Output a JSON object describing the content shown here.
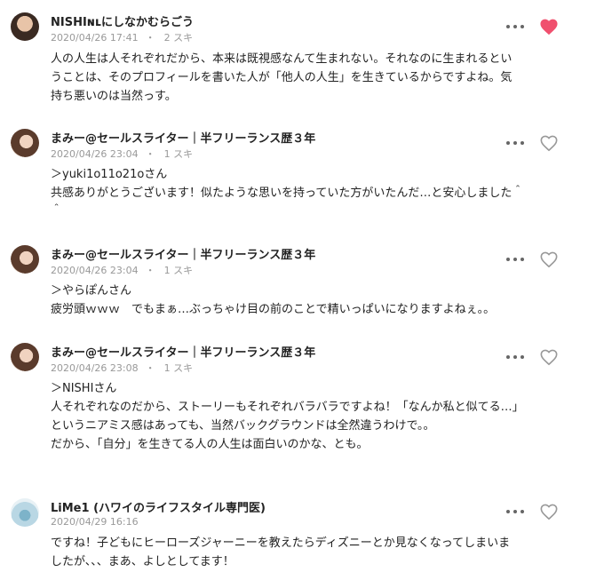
{
  "colors": {
    "liked_heart": "#f0506e",
    "unliked_heart": "#999999",
    "meta_text": "#999999",
    "body_text": "#222222"
  },
  "comments": [
    {
      "author": "NISHIɴʟにしなかむらごう",
      "date": "2020/04/26 17:41",
      "separator": "・",
      "likes": "2 スキ",
      "liked": true,
      "lines": [
        "人の人生は人それぞれだから、本来は既視感なんて生まれない。それなのに生まれるとい",
        "うことは、そのプロフィールを書いた人が「他人の人生」を生きているからですよね。気",
        "持ち悪いのは当然っす。"
      ]
    },
    {
      "author": "まみー@セールスライター｜半フリーランス歴３年",
      "date": "2020/04/26 23:04",
      "separator": "・",
      "likes": "1 スキ",
      "liked": false,
      "lines": [
        "＞yuki1o11o21oさん",
        "共感ありがとうございます！似たような思いを持っていた方がいたんだ…と安心しました＾",
        "＾"
      ]
    },
    {
      "author": "まみー@セールスライター｜半フリーランス歴３年",
      "date": "2020/04/26 23:04",
      "separator": "・",
      "likes": "1 スキ",
      "liked": false,
      "lines": [
        "＞やらぽんさん",
        "疲労頭ｗｗｗ　でもまぁ…ぶっちゃけ目の前のことで精いっぱいになりますよねぇ。。"
      ]
    },
    {
      "author": "まみー@セールスライター｜半フリーランス歴３年",
      "date": "2020/04/26 23:08",
      "separator": "・",
      "likes": "1 スキ",
      "liked": false,
      "lines": [
        "＞NISHIさん",
        "人それぞれなのだから、ストーリーもそれぞれバラバラですよね！「なんか私と似てる…」",
        "というニアミス感はあっても、当然バックグラウンドは全然違うわけで。。",
        "",
        "だから、「自分」を生きてる人の人生は面白いのかな、とも。"
      ]
    },
    {
      "author": "LiMe1 (ハワイのライフスタイル専門医)",
      "date": "2020/04/29 16:16",
      "separator": "",
      "likes": "",
      "liked": false,
      "lines": [
        "ですね！子どもにヒーローズジャーニーを教えたらディズニーとか見なくなってしまいま",
        "したが、、、まあ、よしとしてます！"
      ]
    }
  ]
}
